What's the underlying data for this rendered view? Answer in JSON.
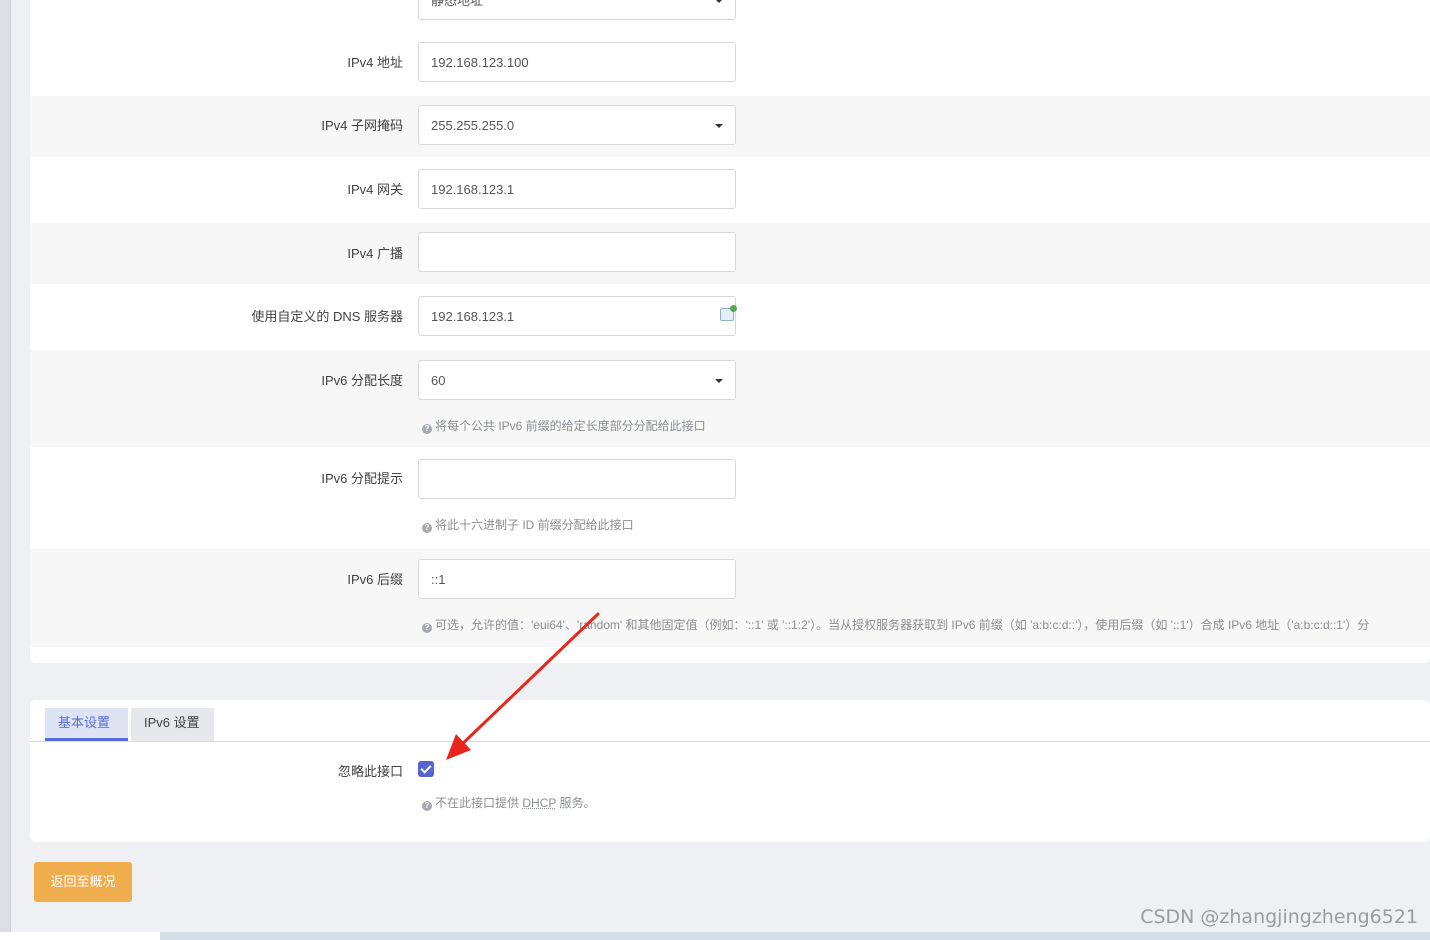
{
  "form": {
    "protocol_value": "静态地址",
    "fields": [
      {
        "label": "IPv4 地址",
        "value": "192.168.123.100"
      },
      {
        "label": "IPv4 子网掩码",
        "value": "255.255.255.0"
      },
      {
        "label": "IPv4 网关",
        "value": "192.168.123.1"
      },
      {
        "label": "IPv4 广播",
        "value": ""
      },
      {
        "label": "使用自定义的 DNS 服务器",
        "value": "192.168.123.1"
      },
      {
        "label": "IPv6 分配长度",
        "value": "60",
        "help": "将每个公共 IPv6 前缀的给定长度部分分配给此接口"
      },
      {
        "label": "IPv6 分配提示",
        "value": "",
        "help": "将此十六进制子 ID 前缀分配给此接口"
      },
      {
        "label": "IPv6 后缀",
        "value": "::1",
        "help": "可选，允许的值：'eui64'、'random' 和其他固定值（例如：'::1' 或 '::1:2'）。当从授权服务器获取到 IPv6 前缀（如 'a:b:c:d::'），使用后缀（如 '::1'）合成 IPv6 地址（'a:b:c:d::1'）分"
      }
    ]
  },
  "dhcp": {
    "tabs": [
      "基本设置",
      "IPv6 设置"
    ],
    "ignore_label": "忽略此接口",
    "ignore_checked": true,
    "help_prefix": "不在此接口提供",
    "help_abbr": "DHCP",
    "help_suffix": "服务。"
  },
  "back_button": "返回至概况",
  "watermark": "CSDN @zhangjingzheng6521",
  "colors": {
    "accent": "#5664d2",
    "button": "#f0ad4e",
    "arrow": "#e8261c"
  }
}
